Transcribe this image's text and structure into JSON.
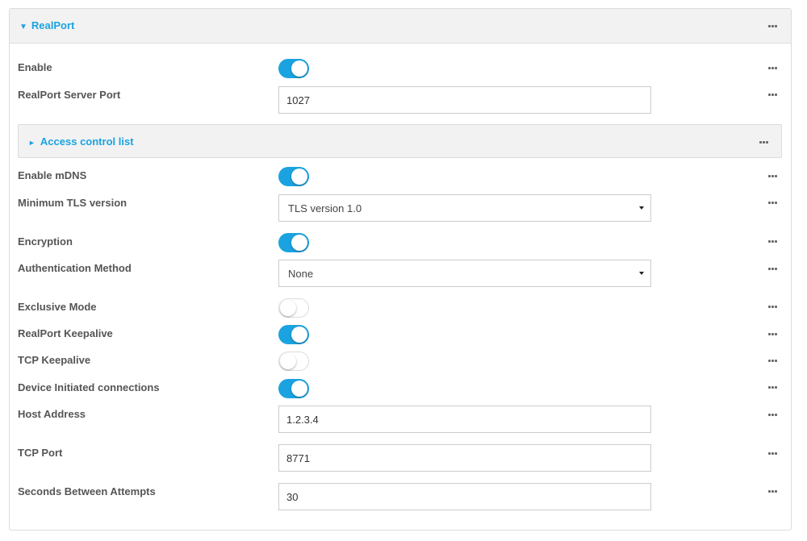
{
  "section": {
    "title": "RealPort",
    "expand_icon": "triangle-down-icon",
    "menu_icon": "more-icon"
  },
  "fields": {
    "enable": {
      "label": "Enable",
      "on": true
    },
    "server_port": {
      "label": "RealPort Server Port",
      "value": "1027"
    },
    "acl": {
      "label": "Access control list",
      "expand_icon": "triangle-right-icon"
    },
    "enable_mdns": {
      "label": "Enable mDNS",
      "on": true
    },
    "min_tls": {
      "label": "Minimum TLS version",
      "value": "TLS version 1.0"
    },
    "encryption": {
      "label": "Encryption",
      "on": true
    },
    "auth_method": {
      "label": "Authentication Method",
      "value": "None"
    },
    "exclusive_mode": {
      "label": "Exclusive Mode",
      "on": false
    },
    "realport_keepalive": {
      "label": "RealPort Keepalive",
      "on": true
    },
    "tcp_keepalive": {
      "label": "TCP Keepalive",
      "on": false
    },
    "device_initiated": {
      "label": "Device Initiated connections",
      "on": true
    },
    "host_address": {
      "label": "Host Address",
      "value": "1.2.3.4"
    },
    "tcp_port": {
      "label": "TCP Port",
      "value": "8771"
    },
    "seconds_between": {
      "label": "Seconds Between Attempts",
      "value": "30"
    }
  },
  "colors": {
    "accent": "#1aa3e0",
    "header_bg": "#f2f2f2",
    "label": "#555555"
  }
}
